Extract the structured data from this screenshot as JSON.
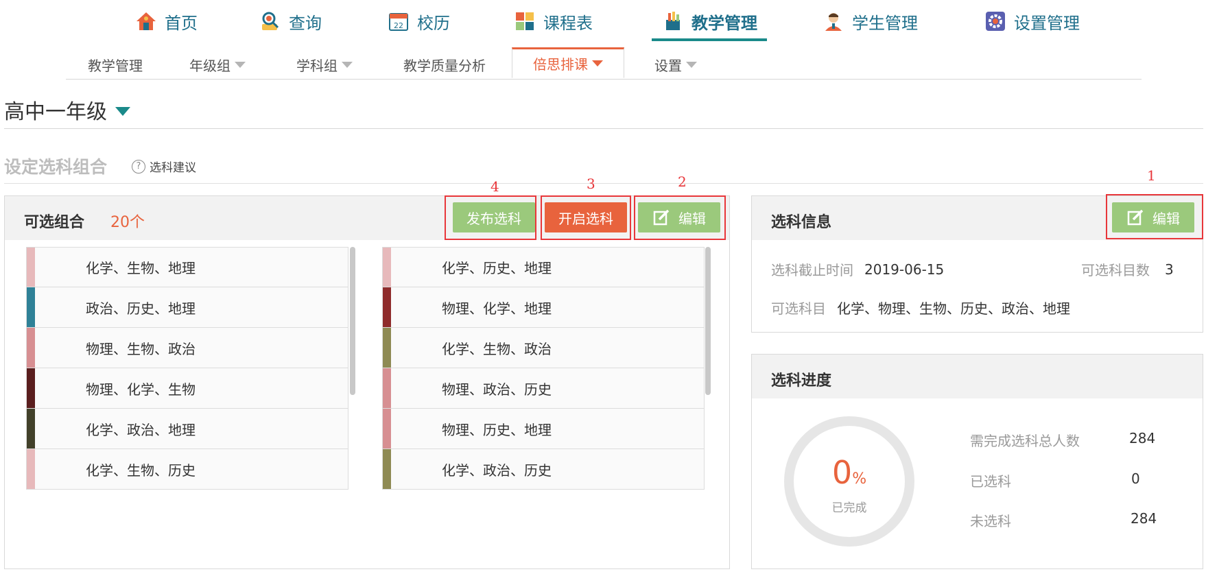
{
  "topnav": {
    "home": "首页",
    "query": "查询",
    "calendar": "校历",
    "timetable": "课程表",
    "teaching": "教学管理",
    "students": "学生管理",
    "settings": "设置管理",
    "calendar_day": "22"
  },
  "subnav": {
    "teaching": "教学管理",
    "grade_group": "年级组",
    "subject_group": "学科组",
    "quality": "教学质量分析",
    "scheduling": "倍思排课",
    "settings": "设置"
  },
  "grade": {
    "label": "高中一年级"
  },
  "section": {
    "title": "设定选科组合",
    "hint": "选科建议"
  },
  "combos": {
    "title": "可选组合",
    "count": "20个",
    "buttons": {
      "publish": "发布选科",
      "open": "开启选科",
      "edit": "编辑"
    },
    "annotations": {
      "publish": "4",
      "open": "3",
      "edit": "2"
    },
    "left": [
      {
        "text": "化学、生物、地理",
        "color": "#e7b9bb"
      },
      {
        "text": "政治、历史、地理",
        "color": "#2f8197"
      },
      {
        "text": "物理、生物、政治",
        "color": "#d78f92"
      },
      {
        "text": "物理、化学、生物",
        "color": "#5a1e1e"
      },
      {
        "text": "化学、政治、地理",
        "color": "#42412a"
      },
      {
        "text": "化学、生物、历史",
        "color": "#e7b9bb"
      }
    ],
    "right": [
      {
        "text": "化学、历史、地理",
        "color": "#e7b9bb"
      },
      {
        "text": "物理、化学、地理",
        "color": "#8f2b2b"
      },
      {
        "text": "化学、生物、政治",
        "color": "#8e8a53"
      },
      {
        "text": "物理、政治、历史",
        "color": "#d78f92"
      },
      {
        "text": "物理、历史、地理",
        "color": "#d78f92"
      },
      {
        "text": "化学、政治、历史",
        "color": "#8e8a53"
      }
    ]
  },
  "info": {
    "title": "选科信息",
    "edit": "编辑",
    "annotation": "1",
    "deadline_label": "选科截止时间",
    "deadline": "2019-06-15",
    "count_label": "可选科目数",
    "count": "3",
    "subjects_label": "可选科目",
    "subjects": "化学、物理、生物、历史、政治、地理"
  },
  "progress": {
    "title": "选科进度",
    "percent": "0",
    "percent_sign": "%",
    "done_label": "已完成",
    "total_label": "需完成选科总人数",
    "total": "284",
    "selected_label": "已选科",
    "selected": "0",
    "unselected_label": "未选科",
    "unselected": "284"
  },
  "colors": {
    "accent": "#e8633d",
    "green": "#9bc97c",
    "teal": "#1a8a8a",
    "annotation": "#e8363a"
  }
}
